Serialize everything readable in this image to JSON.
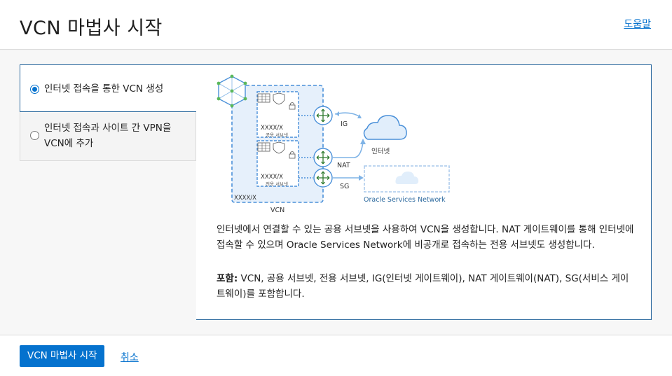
{
  "header": {
    "title": "VCN 마법사 시작",
    "help": "도움말"
  },
  "options": [
    {
      "label": "인터넷 접속을 통한 VCN 생성",
      "selected": true
    },
    {
      "label": "인터넷 접속과 사이트 간 VPN을 VCN에 추가",
      "selected": false
    }
  ],
  "diagram": {
    "public_subnet_label": "공용 서브넷",
    "private_subnet_label": "전용 서브넷",
    "subnet_cidr": "XXXX/X",
    "vcn_cidr": "XXXX/X",
    "vcn_label": "VCN",
    "ig_label": "IG",
    "nat_label": "NAT",
    "sg_label": "SG",
    "internet_label": "인터넷",
    "osn_label": "Oracle Services Network"
  },
  "detail": {
    "description": "인터넷에서 연결할 수 있는 공용 서브넷을 사용하여 VCN을 생성합니다. NAT 게이트웨이를 통해 인터넷에 접속할 수 있으며 Oracle Services Network에 비공개로 접속하는 전용 서브넷도 생성합니다.",
    "includes_label": "포함:",
    "includes_text": "VCN, 공용 서브넷, 전용 서브넷, IG(인터넷 게이트웨이), NAT 게이트웨이(NAT), SG(서비스 게이트웨이)를 포함합니다."
  },
  "footer": {
    "start_button": "VCN 마법사 시작",
    "cancel": "취소"
  },
  "colors": {
    "accent": "#0572ce",
    "border_selected": "#2d6a9f",
    "diagram_blue": "#4a90d9"
  }
}
